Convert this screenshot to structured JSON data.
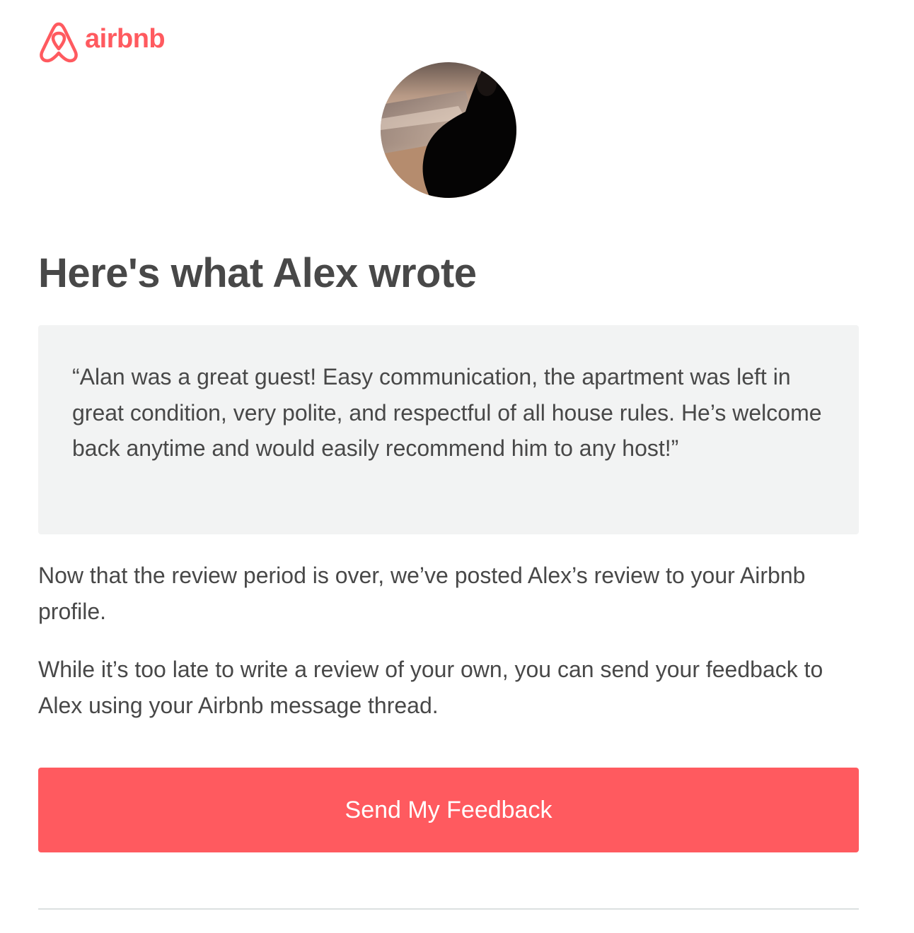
{
  "brand": {
    "name": "airbnb",
    "color": "#FF5A5F",
    "icon": "airbnb-belo-icon"
  },
  "avatar": {
    "icon": "host-profile-photo"
  },
  "heading": "Here's what Alex wrote",
  "review": {
    "text": "“Alan was a great guest! Easy communication, the apartment was left in great condition, very polite, and respectful of all house rules. He’s welcome back anytime and would easily recommend him to any host!”",
    "background": "#F2F3F3"
  },
  "body": {
    "paragraph_1": "Now that the review period is over, we’ve posted Alex’s review to your Airbnb profile.",
    "paragraph_2": "While it’s too late to write a review of your own, you can send your feedback to Alex using your Airbnb message thread."
  },
  "cta": {
    "label": "Send My Feedback",
    "color": "#FF5A5F"
  }
}
